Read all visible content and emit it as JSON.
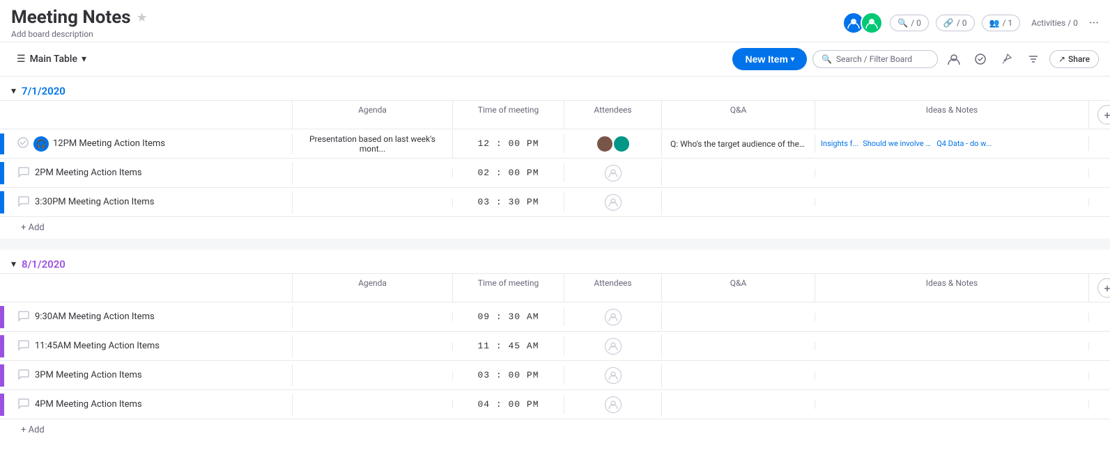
{
  "header": {
    "title": "Meeting Notes",
    "description": "Add board description",
    "star_icon": "★",
    "avatars": [
      {
        "label": "U1",
        "color": "#0073ea"
      },
      {
        "label": "U2",
        "color": "#00c875"
      }
    ],
    "counters": [
      {
        "icon": "🔍",
        "value": "/ 0"
      },
      {
        "icon": "🔗",
        "value": "/ 0"
      },
      {
        "icon": "👥",
        "value": "/ 1"
      }
    ],
    "activities_label": "Activities / 0",
    "more_icon": "···"
  },
  "toolbar": {
    "table_icon": "☰",
    "table_name": "Main Table",
    "chevron": "▾",
    "new_item_label": "New Item",
    "new_item_chevron": "▾",
    "search_placeholder": "Search / Filter Board",
    "share_label": "Share",
    "share_icon": "↗"
  },
  "groups": [
    {
      "id": "group1",
      "color": "blue",
      "color_hex": "#0073ea",
      "title": "7/1/2020",
      "columns": [
        "Agenda",
        "Time of meeting",
        "Attendees",
        "Q&A",
        "Ideas & Notes"
      ],
      "rows": [
        {
          "name": "12PM Meeting Action Items",
          "has_check": true,
          "has_headphone": true,
          "agenda": "Presentation based on last week's mont...",
          "time": "12 : 00 PM",
          "attendees": [
            "brown",
            "teal"
          ],
          "qa": "Q: Who's the target audience of the pres...",
          "ideas": [
            "Insights f...",
            "Should we involve th...",
            "Q4 Data - do w..."
          ]
        },
        {
          "name": "2PM Meeting Action Items",
          "has_check": false,
          "has_headphone": false,
          "agenda": "",
          "time": "02 : 00 PM",
          "attendees": [],
          "qa": "",
          "ideas": []
        },
        {
          "name": "3:30PM Meeting Action Items",
          "has_check": false,
          "has_headphone": false,
          "agenda": "",
          "time": "03 : 30 PM",
          "attendees": [],
          "qa": "",
          "ideas": []
        }
      ],
      "add_label": "+ Add"
    },
    {
      "id": "group2",
      "color": "purple",
      "color_hex": "#9b51e0",
      "title": "8/1/2020",
      "columns": [
        "Agenda",
        "Time of meeting",
        "Attendees",
        "Q&A",
        "Ideas & Notes"
      ],
      "rows": [
        {
          "name": "9:30AM Meeting Action Items",
          "has_check": false,
          "has_headphone": false,
          "agenda": "",
          "time": "09 : 30 AM",
          "attendees": [],
          "qa": "",
          "ideas": []
        },
        {
          "name": "11:45AM Meeting Action Items",
          "has_check": false,
          "has_headphone": false,
          "agenda": "",
          "time": "11 : 45 AM",
          "attendees": [],
          "qa": "",
          "ideas": []
        },
        {
          "name": "3PM Meeting Action Items",
          "has_check": false,
          "has_headphone": false,
          "agenda": "",
          "time": "03 : 00 PM",
          "attendees": [],
          "qa": "",
          "ideas": []
        },
        {
          "name": "4PM Meeting Action Items",
          "has_check": false,
          "has_headphone": false,
          "agenda": "",
          "time": "04 : 00 PM",
          "attendees": [],
          "qa": "",
          "ideas": []
        }
      ],
      "add_label": "+ Add"
    }
  ]
}
